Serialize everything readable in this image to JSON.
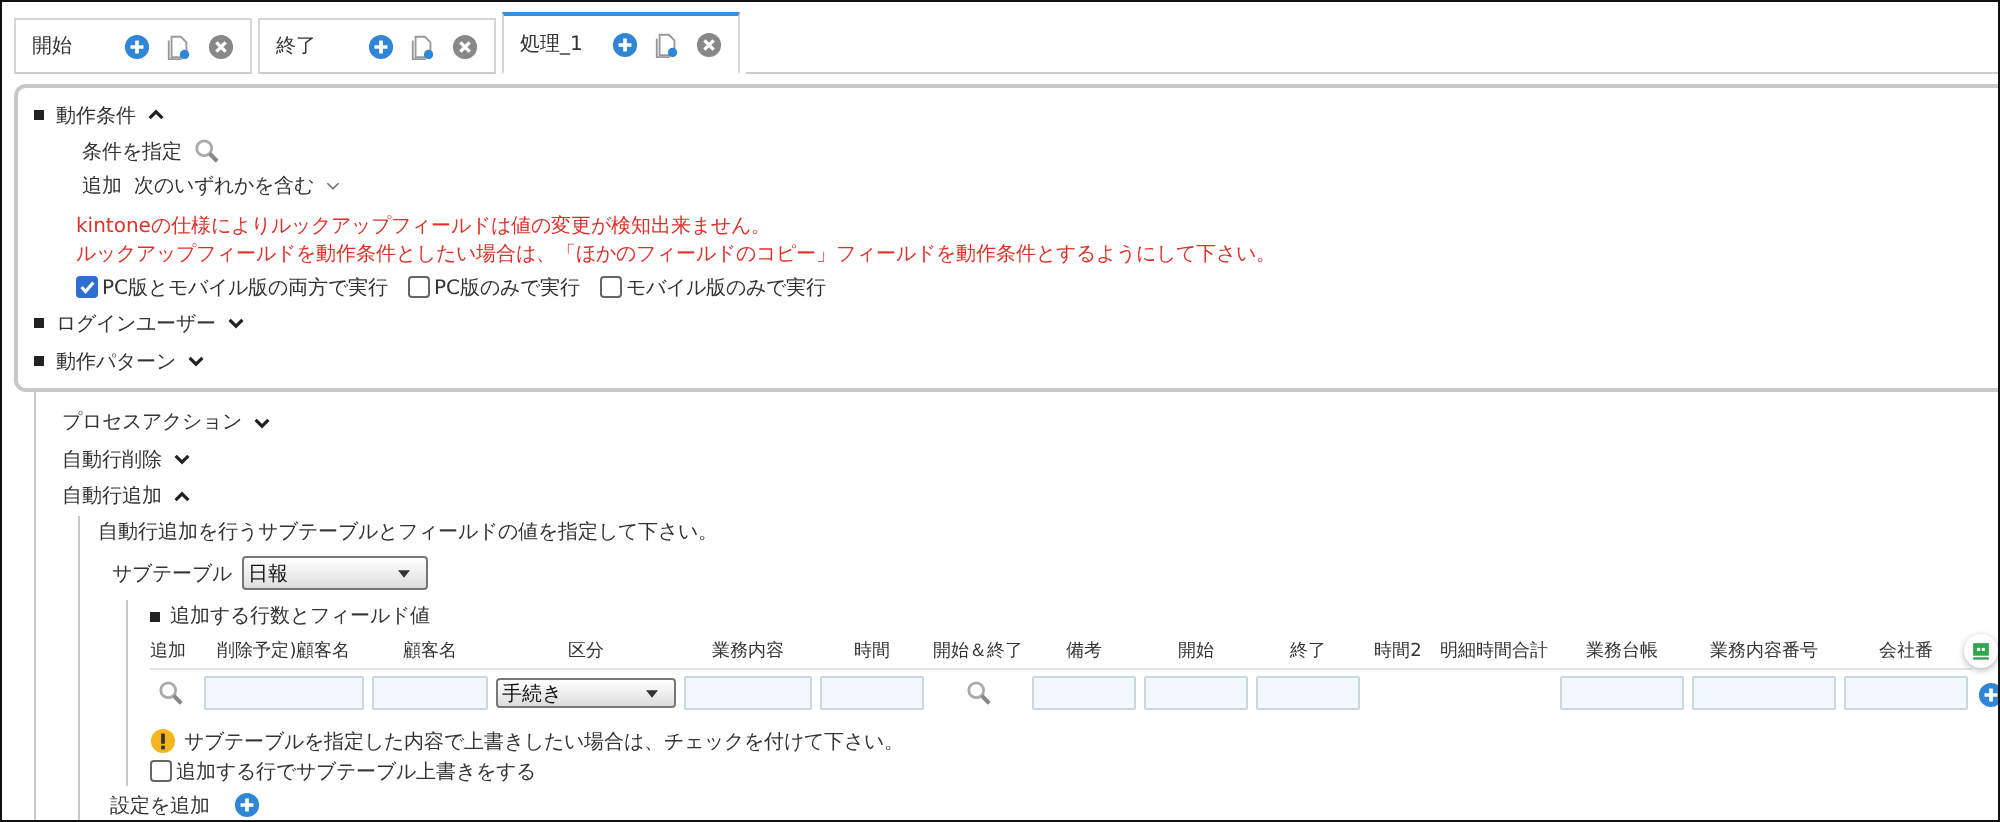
{
  "tabs": [
    {
      "label": "開始",
      "selected": false
    },
    {
      "label": "終了",
      "selected": false
    },
    {
      "label": "処理_1",
      "selected": true
    }
  ],
  "conditions": {
    "title": "動作条件",
    "expanded": true,
    "condition_label": "条件を指定",
    "condition_field": "追加",
    "condition_operator": "次のいずれかを含む",
    "warnings": [
      "kintoneの仕様によりルックアップフィールドは値の変更が検知出来ません。",
      "ルックアップフィールドを動作条件としたい場合は、「ほかのフィールドのコピー」フィールドを動作条件とするようにして下さい。"
    ],
    "options": [
      {
        "label": "PC版とモバイル版の両方で実行",
        "checked": true
      },
      {
        "label": "PC版のみで実行",
        "checked": false
      },
      {
        "label": "モバイル版のみで実行",
        "checked": false
      }
    ]
  },
  "sections": [
    {
      "title": "ログインユーザー",
      "expanded": false
    },
    {
      "title": "動作パターン",
      "expanded": false
    }
  ],
  "pattern_items": [
    {
      "title": "プロセスアクション",
      "expanded": false
    },
    {
      "title": "自動行削除",
      "expanded": false
    },
    {
      "title": "自動行追加",
      "expanded": true
    }
  ],
  "auto_add": {
    "instruction": "自動行追加を行うサブテーブルとフィールドの値を指定して下さい。",
    "subtable_label": "サブテーブル",
    "subtable_value": "日報",
    "fields_title": "追加する行数とフィールド値",
    "columns": [
      {
        "header": "追加",
        "kind": "icon"
      },
      {
        "header": "削除予定)顧客名",
        "kind": "input"
      },
      {
        "header": "顧客名",
        "kind": "input"
      },
      {
        "header": "区分",
        "kind": "select",
        "value": "手続き"
      },
      {
        "header": "業務内容",
        "kind": "input"
      },
      {
        "header": "時間",
        "kind": "input"
      },
      {
        "header": "開始＆終了",
        "kind": "icon"
      },
      {
        "header": "備考",
        "kind": "input"
      },
      {
        "header": "開始",
        "kind": "input"
      },
      {
        "header": "終了",
        "kind": "input"
      },
      {
        "header": "時間2",
        "kind": "empty"
      },
      {
        "header": "明細時間合計",
        "kind": "empty"
      },
      {
        "header": "業務台帳",
        "kind": "input"
      },
      {
        "header": "業務内容番号",
        "kind": "input"
      },
      {
        "header": "会社番",
        "kind": "input"
      }
    ],
    "note": "サブテーブルを指定した内容で上書きしたい場合は、チェックを付けて下さい。",
    "overwrite": {
      "label": "追加する行でサブテーブル上書きをする",
      "checked": false
    }
  },
  "add_setting": "設定を追加"
}
